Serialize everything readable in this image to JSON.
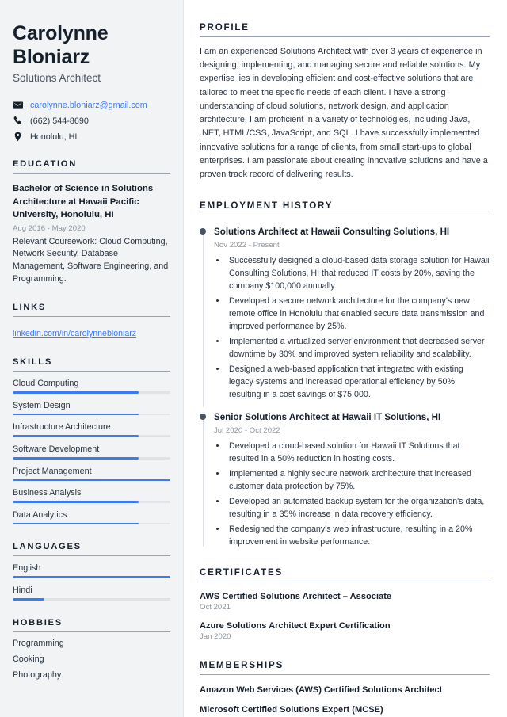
{
  "header": {
    "name": "Carolynne Bloniarz",
    "job_title": "Solutions Architect",
    "contacts": [
      {
        "icon": "envelope-icon",
        "value": "carolynne.bloniarz@gmail.com",
        "is_link": true
      },
      {
        "icon": "phone-icon",
        "value": "(662) 544-8690",
        "is_link": false
      },
      {
        "icon": "location-pin-icon",
        "value": "Honolulu, HI",
        "is_link": false
      }
    ]
  },
  "education": {
    "title": "EDUCATION",
    "items": [
      {
        "degree": "Bachelor of Science in Solutions Architecture at Hawaii Pacific University, Honolulu, HI",
        "date": "Aug 2016 - May 2020",
        "description": "Relevant Coursework: Cloud Computing, Network Security, Database Management, Software Engineering, and Programming."
      }
    ]
  },
  "links": {
    "title": "LINKS",
    "items": [
      {
        "label": "linkedin.com/in/carolynnebloniarz"
      }
    ]
  },
  "skills": {
    "title": "SKILLS",
    "items": [
      {
        "label": "Cloud Computing",
        "level": 80
      },
      {
        "label": "System Design",
        "level": 80
      },
      {
        "label": "Infrastructure Architecture",
        "level": 80
      },
      {
        "label": "Software Development",
        "level": 80
      },
      {
        "label": "Project Management",
        "level": 100
      },
      {
        "label": "Business Analysis",
        "level": 80
      },
      {
        "label": "Data Analytics",
        "level": 80
      }
    ]
  },
  "languages": {
    "title": "LANGUAGES",
    "items": [
      {
        "label": "English",
        "level": 100
      },
      {
        "label": "Hindi",
        "level": 20
      }
    ]
  },
  "hobbies": {
    "title": "HOBBIES",
    "items": [
      {
        "label": "Programming"
      },
      {
        "label": "Cooking"
      },
      {
        "label": "Photography"
      }
    ]
  },
  "profile": {
    "title": "PROFILE",
    "text": "I am an experienced Solutions Architect with over 3 years of experience in designing, implementing, and managing secure and reliable solutions. My expertise lies in developing efficient and cost-effective solutions that are tailored to meet the specific needs of each client. I have a strong understanding of cloud solutions, network design, and application architecture. I am proficient in a variety of technologies, including Java, .NET, HTML/CSS, JavaScript, and SQL. I have successfully implemented innovative solutions for a range of clients, from small start-ups to global enterprises. I am passionate about creating innovative solutions and have a proven track record of delivering results."
  },
  "employment": {
    "title": "EMPLOYMENT HISTORY",
    "jobs": [
      {
        "role": "Solutions Architect at Hawaii Consulting Solutions, HI",
        "date": "Nov 2022 - Present",
        "bullets": [
          "Successfully designed a cloud-based data storage solution for Hawaii Consulting Solutions, HI that reduced IT costs by 20%, saving the company $100,000 annually.",
          "Developed a secure network architecture for the company's new remote office in Honolulu that enabled secure data transmission and improved performance by 25%.",
          "Implemented a virtualized server environment that decreased server downtime by 30% and improved system reliability and scalability.",
          "Designed a web-based application that integrated with existing legacy systems and increased operational efficiency by 50%, resulting in a cost savings of $75,000."
        ]
      },
      {
        "role": "Senior Solutions Architect at Hawaii IT Solutions, HI",
        "date": "Jul 2020 - Oct 2022",
        "bullets": [
          "Developed a cloud-based solution for Hawaii IT Solutions that resulted in a 50% reduction in hosting costs.",
          "Implemented a highly secure network architecture that increased customer data protection by 75%.",
          "Developed an automated backup system for the organization's data, resulting in a 35% increase in data recovery efficiency.",
          "Redesigned the company's web infrastructure, resulting in a 20% improvement in website performance."
        ]
      }
    ]
  },
  "certificates": {
    "title": "CERTIFICATES",
    "items": [
      {
        "name": "AWS Certified Solutions Architect – Associate",
        "date": "Oct 2021"
      },
      {
        "name": "Azure Solutions Architect Expert Certification",
        "date": "Jan 2020"
      }
    ]
  },
  "memberships": {
    "title": "MEMBERSHIPS",
    "items": [
      {
        "name": "Amazon Web Services (AWS) Certified Solutions Architect"
      },
      {
        "name": "Microsoft Certified Solutions Expert (MCSE)"
      }
    ]
  },
  "theme": {
    "accent": "#3b7bf7",
    "heading": "#16202c",
    "body_text": "#2b3542",
    "muted": "#8d959e",
    "sidebar_bg": "#f1f3f5"
  }
}
